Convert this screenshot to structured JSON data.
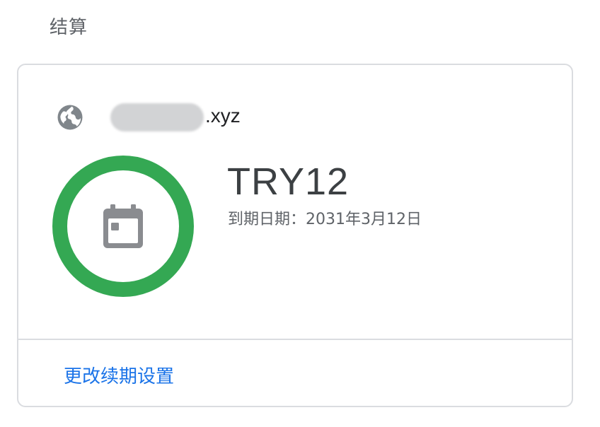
{
  "section": {
    "title": "结算"
  },
  "card": {
    "domain": {
      "icon": "globe-icon",
      "suffix": ".xyz"
    },
    "status": {
      "ring_color": "#34a853",
      "icon": "calendar-icon"
    },
    "plan": {
      "name": "TRY12",
      "expiry_text": "到期日期：2031年3月12日"
    },
    "footer": {
      "renew_link_label": "更改续期设置",
      "link_color": "#1a73e8"
    }
  }
}
